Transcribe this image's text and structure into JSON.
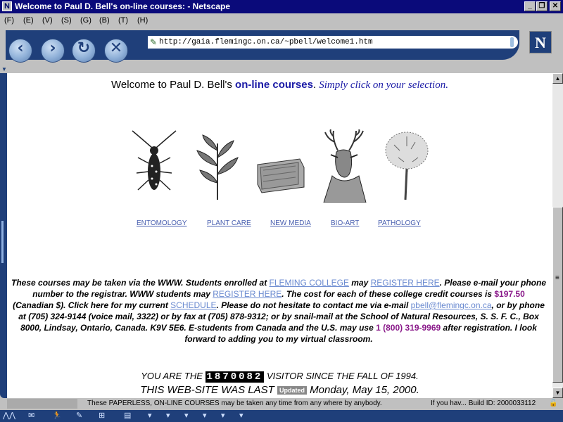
{
  "window": {
    "title": "Welcome to Paul D. Bell's on-line courses: - Netscape",
    "app_icon": "N",
    "min": "_",
    "max": "❐",
    "close": "✕"
  },
  "menu": [
    "(F)",
    "(E)",
    "(V)",
    "(S)",
    "(G)",
    "(B)",
    "(T)",
    "(H)"
  ],
  "toolbar": {
    "back_icon": "‹",
    "forward_icon": "›",
    "reload_icon": "↻",
    "stop_icon": "✕",
    "url": "http://gaia.flemingc.on.ca/~pbell/welcome1.htm",
    "logo": "N"
  },
  "page": {
    "welcome_prefix": "Welcome to Paul D. Bell's ",
    "welcome_link": "on-line courses",
    "welcome_sep": ". ",
    "welcome_italic": "Simply click on your selection",
    "welcome_end": ".",
    "courses": [
      "ENTOMOLOGY",
      "PLANT CARE",
      "NEW MEDIA",
      "BIO-ART",
      "PATHOLOGY"
    ],
    "para": {
      "t1": "These courses may be taken via the WWW. Students enrolled at ",
      "l1": "FLEMING COLLEGE",
      "t2": " may ",
      "l2": "REGISTER HERE",
      "t3": ". Please e-mail your phone number to the registrar. WWW students may ",
      "l3": "REGISTER HERE",
      "t4": ". The cost for each of these college credit courses is ",
      "price": "$197.50",
      "t5": " (Canadian $). Click here for my current ",
      "l4": "SCHEDULE",
      "t6": ". Please do not hesitate to contact me via e-mail ",
      "email": "pbell@flemingc.on.ca",
      "t7": ", or by phone at (705) 324-9144 (voice mail, 3322) or by fax at (705) 878-9312; or by snail-mail at the School of Natural Resources, S. S. F. C., Box 8000, Lindsay, Ontario, Canada. K9V 5E6. E-students from Canada and the U.S. may use ",
      "phone": "1 (800) 319-9969",
      "t8": " after registration. I look forward to adding you to my virtual classroom."
    },
    "visitor_prefix": "YOU ARE THE",
    "counter": "1870082",
    "visitor_suffix": "VISITOR SINCE THE FALL OF 1994.",
    "updated_prefix": "THIS WEB-SITE WAS LAST",
    "updated_badge": "Updated",
    "updated_date": "Monday, May 15, 2000."
  },
  "status": {
    "text": "These     PAPERLESS,   ON-LINE COURSES    may be taken any time from any where by anybody.",
    "build": "If you hav...  Build ID: 2000033112"
  },
  "taskbar": [
    "⋀⋀",
    "✉",
    "🏃",
    "✎",
    "⊞",
    "▤",
    "▾",
    "▾",
    "▾",
    "▾",
    "▾",
    "▾"
  ]
}
